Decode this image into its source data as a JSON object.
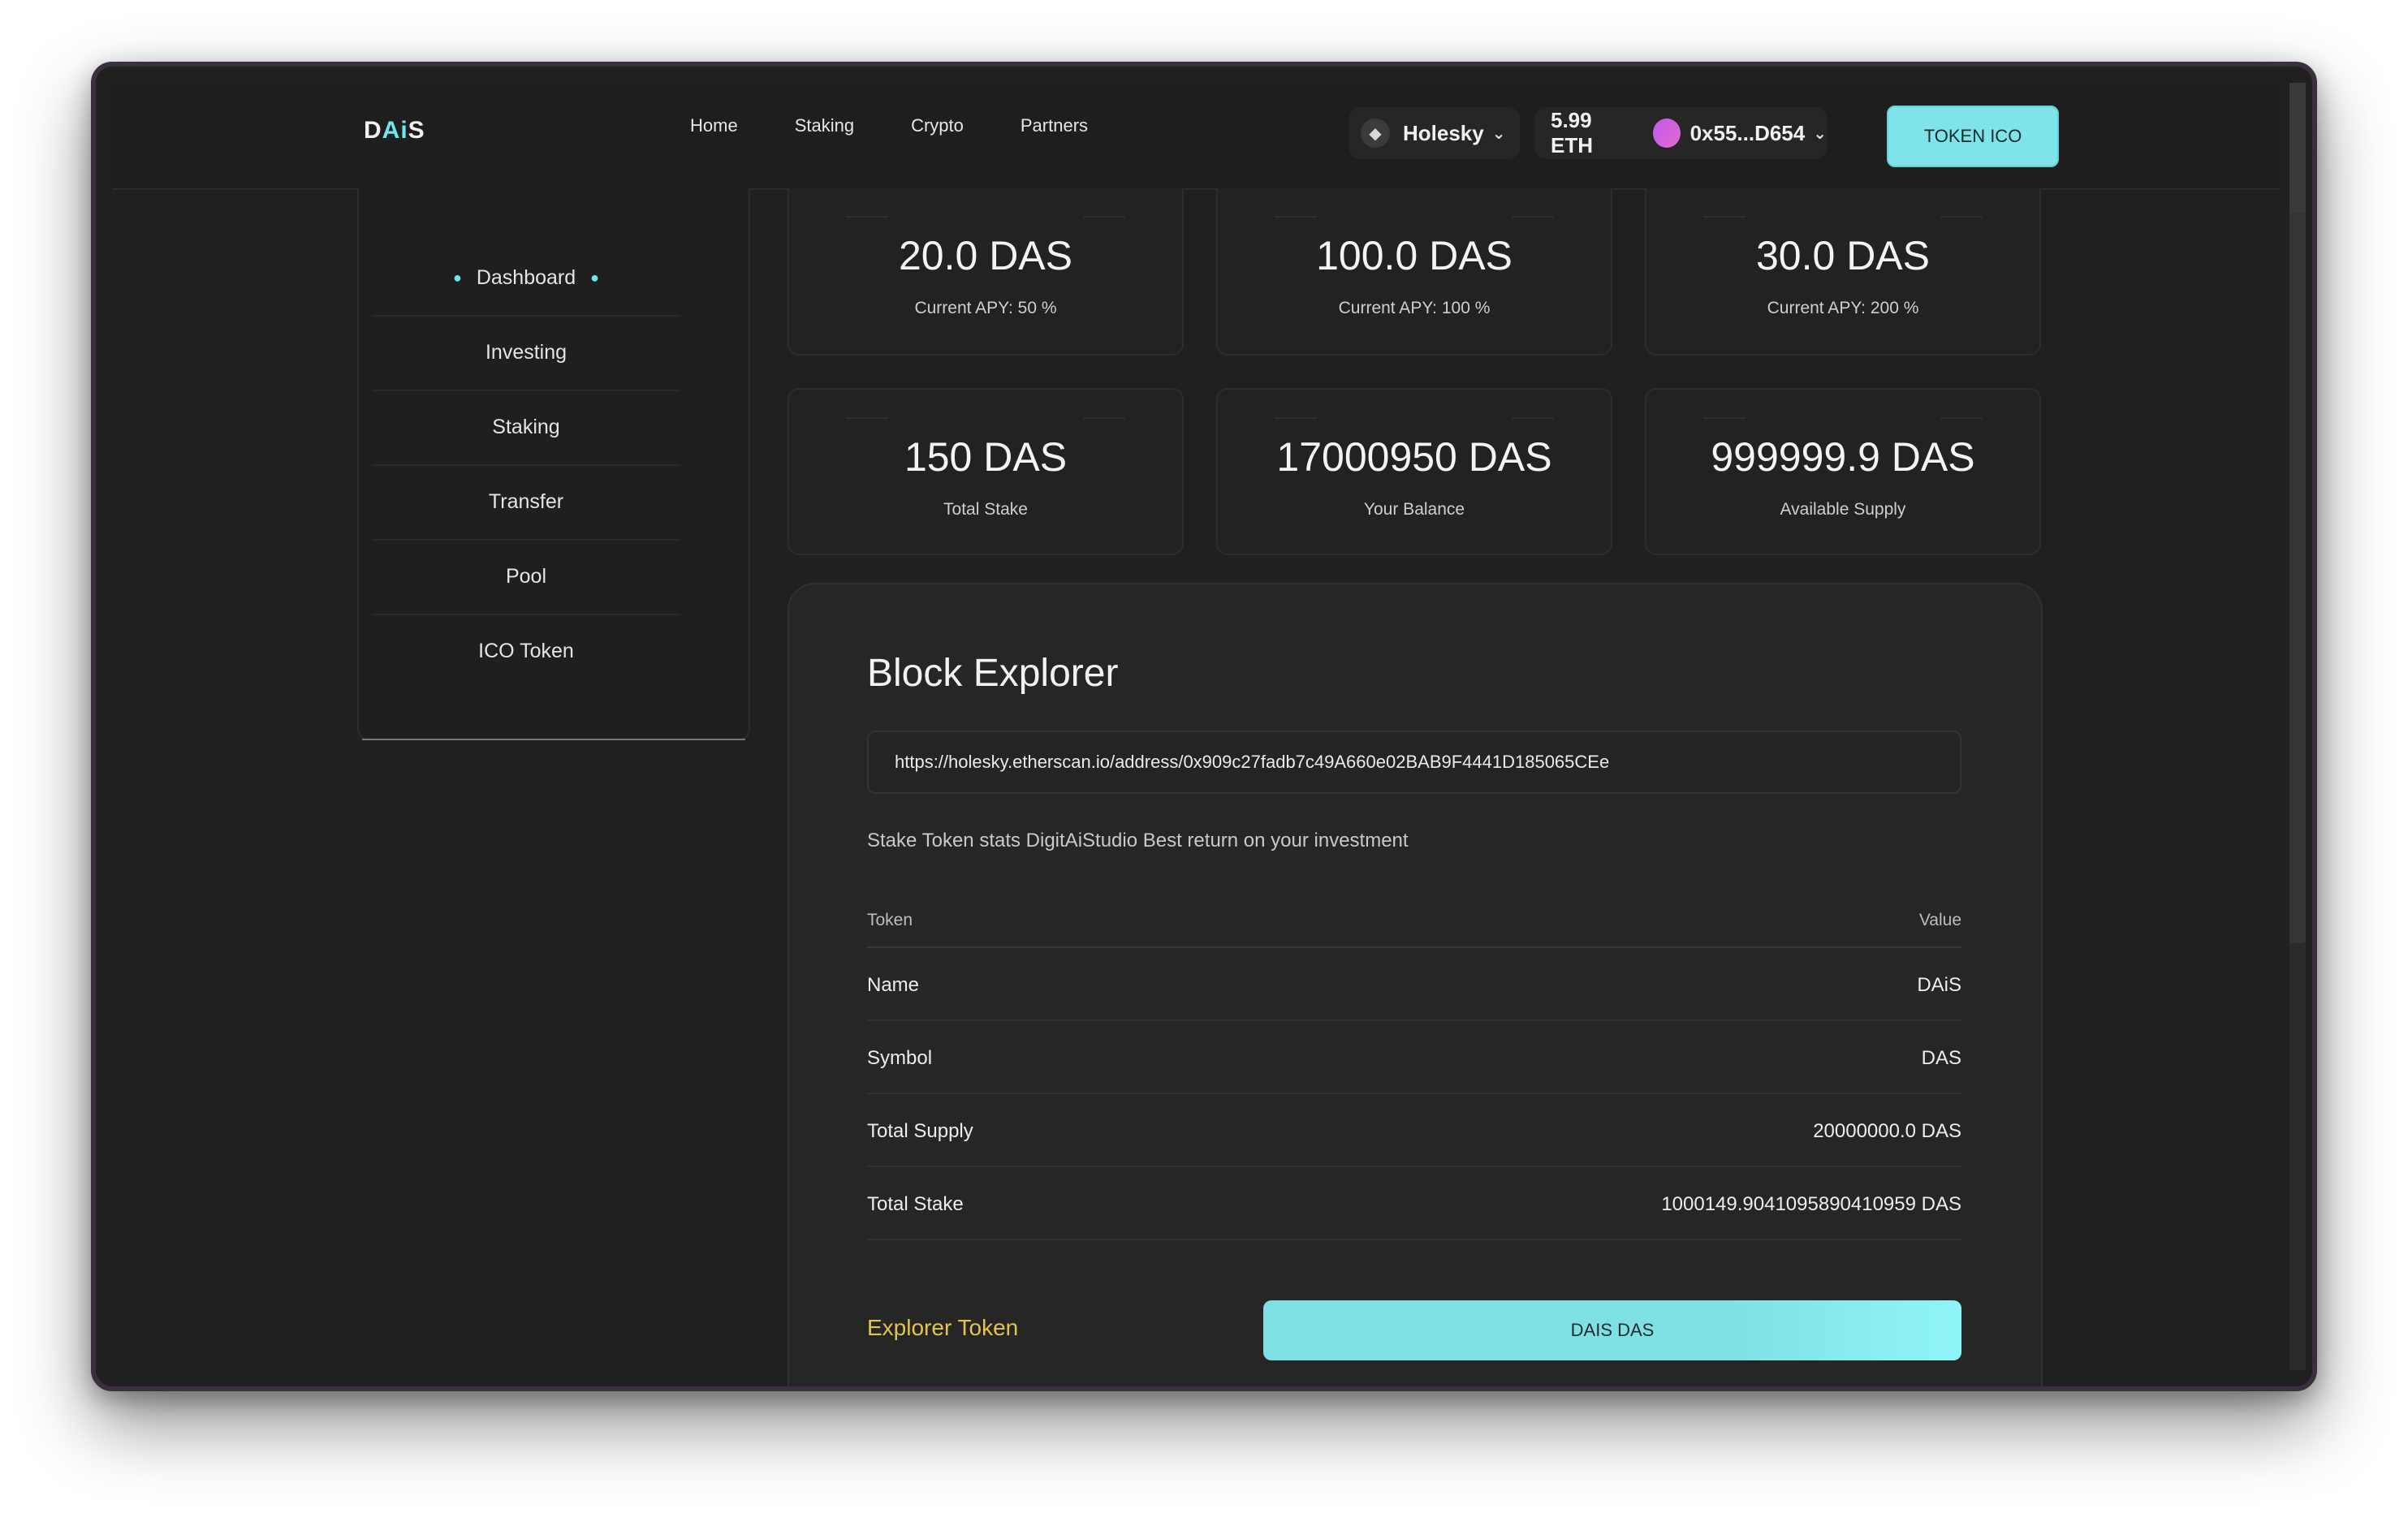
{
  "header": {
    "logo_d": "D",
    "logo_ai": "Ai",
    "logo_s": "S",
    "nav": [
      "Home",
      "Staking",
      "Crypto",
      "Partners"
    ],
    "network": "Holesky",
    "eth_balance": "5.99 ETH",
    "address": "0x55...D654",
    "token_ico_label": "TOKEN ICO"
  },
  "sidebar": {
    "items": [
      "Dashboard",
      "Investing",
      "Staking",
      "Transfer",
      "Pool",
      "ICO Token"
    ],
    "active": "Dashboard"
  },
  "cards": [
    {
      "value": "20.0 DAS",
      "label": "Current APY: 50 %"
    },
    {
      "value": "100.0 DAS",
      "label": "Current APY: 100 %"
    },
    {
      "value": "30.0 DAS",
      "label": "Current APY: 200 %"
    },
    {
      "value": "150 DAS",
      "label": "Total Stake"
    },
    {
      "value": "17000950 DAS",
      "label": "Your Balance"
    },
    {
      "value": "999999.9 DAS",
      "label": "Available Supply"
    }
  ],
  "explorer": {
    "title": "Block Explorer",
    "url": "https://holesky.etherscan.io/address/0x909c27fadb7c49A660e02BAB9F4441D185065CEe",
    "description": "Stake Token stats DigitAiStudio Best return on your investment",
    "columns": [
      "Token",
      "Value"
    ],
    "rows": [
      {
        "key": "Name",
        "value": "DAiS"
      },
      {
        "key": "Symbol",
        "value": "DAS"
      },
      {
        "key": "Total Supply",
        "value": "20000000.0 DAS"
      },
      {
        "key": "Total Stake",
        "value": "1000149.9041095890410959 DAS"
      }
    ],
    "explorer_token_label": "Explorer Token",
    "button_label": "DAIS DAS"
  },
  "colors": {
    "accent": "#7fe4e9",
    "link": "#e3c34a",
    "background": "#202020"
  }
}
